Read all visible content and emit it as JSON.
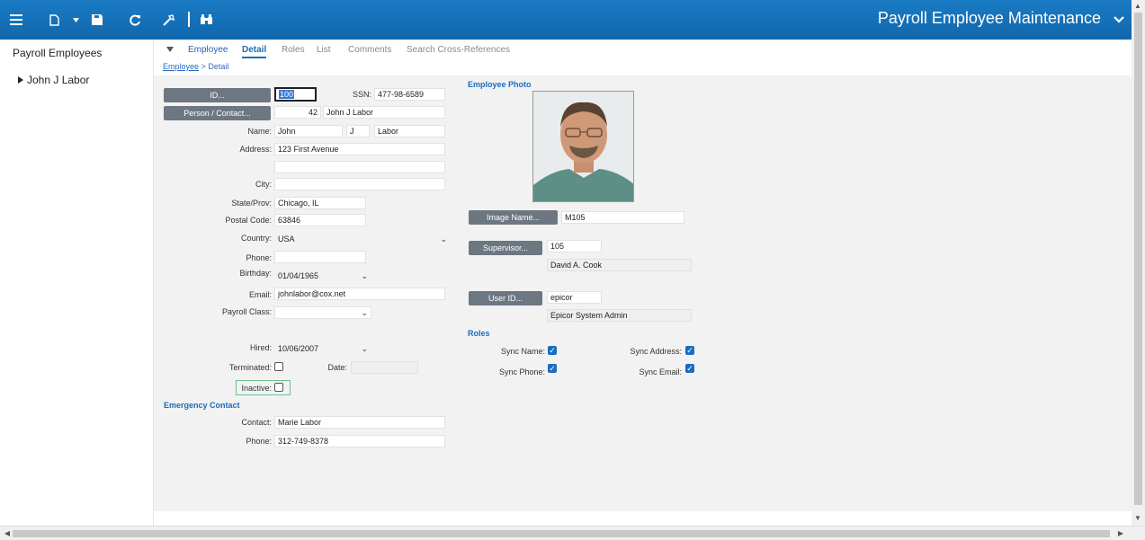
{
  "toolbar": {
    "menu_icon": "hamburger-icon",
    "new_icon": "new-document-icon",
    "new_dropdown_icon": "chevron-down-icon",
    "save_icon": "save-icon",
    "refresh_icon": "refresh-icon",
    "tools_icon": "tools-icon",
    "search_icon": "binoculars-icon"
  },
  "app": {
    "title": "Payroll Employee Maintenance"
  },
  "colors": {
    "topbar": "#1a73ba",
    "accent": "#1a6dc0",
    "button": "#6d7782"
  },
  "tree": {
    "title": "Payroll Employees",
    "node": "John J Labor",
    "node_icon": "triangle-right-icon"
  },
  "tabs": [
    {
      "label": "Employee"
    },
    {
      "label": "Detail"
    },
    {
      "label": "Roles"
    },
    {
      "label": "List"
    },
    {
      "label": "Comments"
    },
    {
      "label": "Search Cross-References"
    }
  ],
  "breadcrumb": {
    "link": "Employee",
    "separator": ">",
    "current": "Detail"
  },
  "form": {
    "id_button": "ID...",
    "id_value": "100",
    "ssn_label": "SSN:",
    "ssn_value": "477-98-6589",
    "person_button": "Person / Contact...",
    "person_id": "42",
    "person_name": "John J Labor",
    "name_label": "Name:",
    "first_name": "John",
    "middle_initial": "J",
    "last_name": "Labor",
    "address_label": "Address:",
    "address1": "123 First Avenue",
    "address2": "",
    "city_label": "City:",
    "city": "",
    "state_label": "State/Prov:",
    "state": "Chicago, IL",
    "postal_label": "Postal Code:",
    "postal": "63846",
    "country_label": "Country:",
    "country": "USA",
    "phone_label": "Phone:",
    "phone": "",
    "birthday_label": "Birthday:",
    "birthday": "01/04/1965",
    "email_label": "Email:",
    "email": "johnlabor@cox.net",
    "payroll_class_label": "Payroll Class:",
    "payroll_class": "",
    "hired_label": "Hired:",
    "hired": "10/06/2007",
    "terminated_label": "Terminated:",
    "terminated": false,
    "date_label": "Date:",
    "term_date": "",
    "inactive_label": "Inactive:",
    "inactive": false
  },
  "emergency": {
    "section_title": "Emergency Contact",
    "contact_label": "Contact:",
    "contact": "Marie Labor",
    "phone_label": "Phone:",
    "phone": "312-749-8378"
  },
  "photo": {
    "section_title": "Employee Photo",
    "image_name_button": "Image Name...",
    "image_name": "M105",
    "supervisor_button": "Supervisor...",
    "supervisor_id": "105",
    "supervisor_name": "David A. Cook",
    "user_id_button": "User ID...",
    "user_id": "epicor",
    "user_name": "Epicor System Admin"
  },
  "roles": {
    "section_title": "Roles",
    "sync_name_label": "Sync Name:",
    "sync_name": true,
    "sync_address_label": "Sync Address:",
    "sync_address": true,
    "sync_phone_label": "Sync Phone:",
    "sync_phone": true,
    "sync_email_label": "Sync Email:",
    "sync_email": true
  }
}
